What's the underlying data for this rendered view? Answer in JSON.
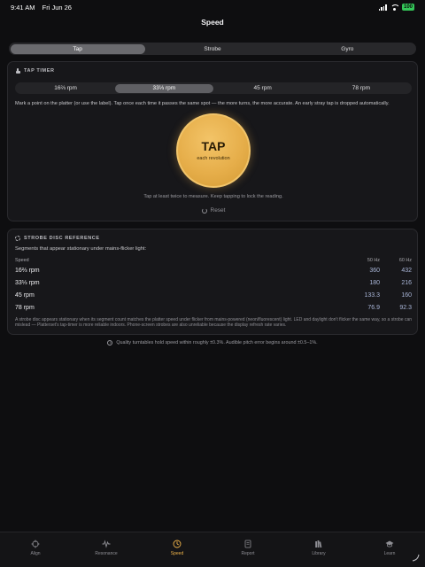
{
  "status": {
    "time": "9:41 AM",
    "date": "Fri Jun 26",
    "battery": "100"
  },
  "nav": {
    "title": "Speed"
  },
  "modes": [
    {
      "label": "Tap",
      "active": true
    },
    {
      "label": "Strobe",
      "active": false
    },
    {
      "label": "Gyro",
      "active": false
    }
  ],
  "tap_timer": {
    "heading": "TAP TIMER",
    "rpm_options": [
      {
        "label": "16⅔ rpm",
        "active": false
      },
      {
        "label": "33⅓ rpm",
        "active": true
      },
      {
        "label": "45 rpm",
        "active": false
      },
      {
        "label": "78 rpm",
        "active": false
      }
    ],
    "instructions": "Mark a point on the platter (or use the label). Tap once each time it passes the same spot — the more turns, the more accurate. An early stray tap is dropped automatically.",
    "tap_label": "TAP",
    "tap_sub": "each revolution",
    "hint": "Tap at least twice to measure. Keep tapping to lock the reading.",
    "reset_label": "Reset"
  },
  "strobe_ref": {
    "heading": "STROBE DISC REFERENCE",
    "subtitle": "Segments that appear stationary under mains-flicker light:",
    "columns": [
      "Speed",
      "50 Hz",
      "60 Hz"
    ],
    "rows": [
      {
        "speed": "16⅔ rpm",
        "hz50": "360",
        "hz60": "432"
      },
      {
        "speed": "33⅓ rpm",
        "hz50": "180",
        "hz60": "216"
      },
      {
        "speed": "45 rpm",
        "hz50": "133.3",
        "hz60": "160"
      },
      {
        "speed": "78 rpm",
        "hz50": "76.9",
        "hz60": "92.3"
      }
    ],
    "note": "A strobe disc appears stationary when its segment count matches the platter speed under flicker from mains-powered (neon/fluorescent) light. LED and daylight don't flicker the same way, so a strobe can mislead — Platterset's tap-timer is more reliable indoors. Phone-screen strobes are also unreliable because the display refresh rate varies."
  },
  "footnote": "Quality turntables hold speed within roughly ±0.3%. Audible pitch error begins around ±0.5–1%.",
  "tabs": [
    {
      "label": "Align",
      "icon": "crosshair-icon",
      "active": false
    },
    {
      "label": "Resonance",
      "icon": "waveform-icon",
      "active": false
    },
    {
      "label": "Speed",
      "icon": "speed-icon",
      "active": true
    },
    {
      "label": "Report",
      "icon": "report-icon",
      "active": false
    },
    {
      "label": "Library",
      "icon": "library-icon",
      "active": false
    },
    {
      "label": "Learn",
      "icon": "graduation-cap-icon",
      "active": false
    }
  ],
  "colors": {
    "accent": "#f0b44a",
    "background": "#0e0e10",
    "card": "#17171a",
    "battery": "#34c759"
  }
}
